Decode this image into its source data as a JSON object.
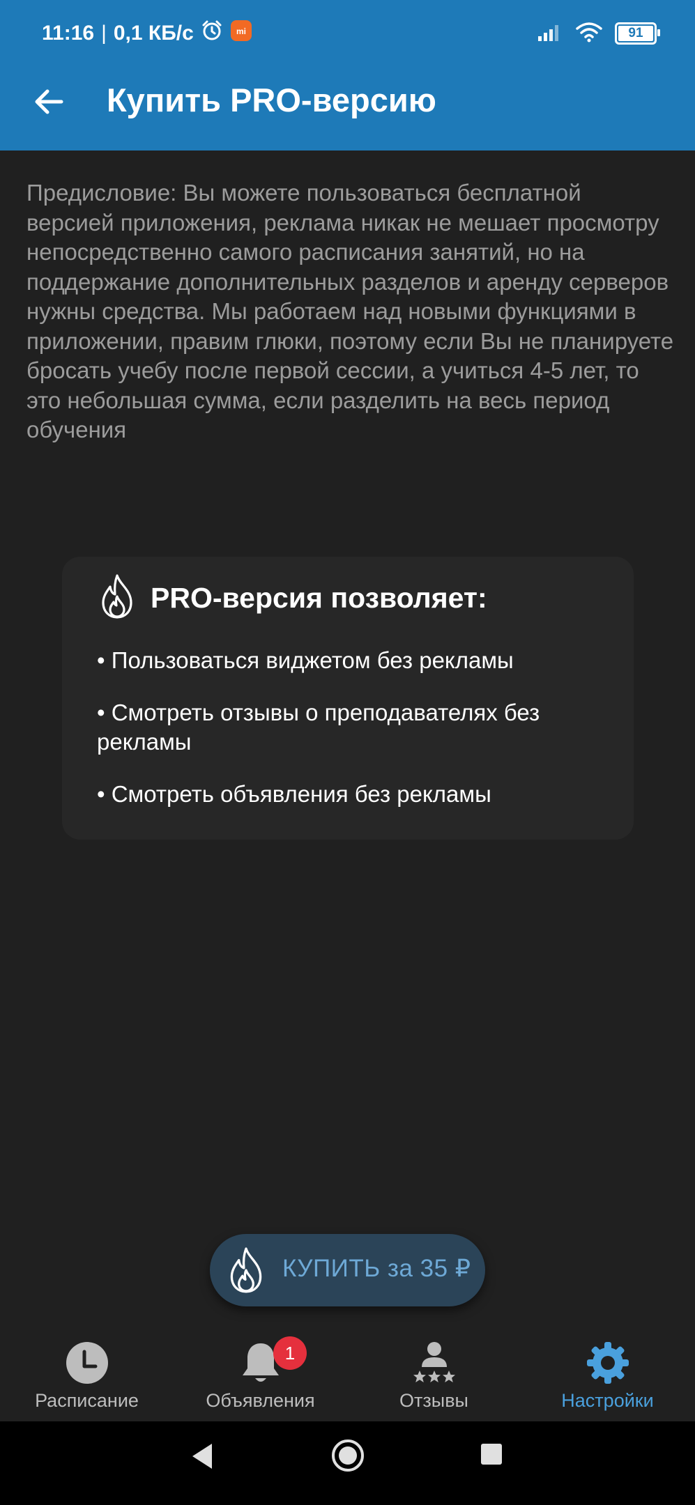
{
  "status_bar": {
    "time": "11:16",
    "network_speed": "0,1 КБ/с",
    "battery_level": "91",
    "icons": [
      "alarm-icon",
      "mi-app-icon",
      "signal-icon",
      "wifi-icon",
      "battery-icon"
    ]
  },
  "app_bar": {
    "title": "Купить PRO-версию",
    "back_icon": "arrow-left-icon"
  },
  "preface": "Предисловие: Вы можете пользоваться бесплатной версией приложения, реклама никак не мешает просмотру непосредственно самого расписания занятий, но на поддержание дополнительных разделов и аренду серверов нужны средства. Мы работаем над новыми функциями в приложении, правим глюки, поэтому если Вы не планируете бросать учебу после первой сессии, а учиться 4-5 лет, то это небольшая сумма, если разделить на весь период обучения",
  "pro_card": {
    "title": "PRO-версия позволяет:",
    "icon": "flame-icon",
    "benefits": [
      "• Пользоваться виджетом без рекламы",
      "• Смотреть отзывы о преподавателях без рекламы",
      "• Смотреть объявления без рекламы"
    ]
  },
  "buy_button": {
    "label": "КУПИТЬ за 35 ₽",
    "icon": "flame-icon"
  },
  "bottom_nav": {
    "items": [
      {
        "label": "Расписание",
        "icon": "clock-icon",
        "active": false
      },
      {
        "label": "Объявления",
        "icon": "bell-icon",
        "active": false,
        "badge": "1"
      },
      {
        "label": "Отзывы",
        "icon": "reviews-icon",
        "active": false
      },
      {
        "label": "Настройки",
        "icon": "gear-icon",
        "active": true
      }
    ]
  },
  "colors": {
    "primary": "#1e7ab8",
    "background": "#202020",
    "card": "#272727",
    "accent": "#4aa0dd",
    "badge": "#e5303d"
  }
}
